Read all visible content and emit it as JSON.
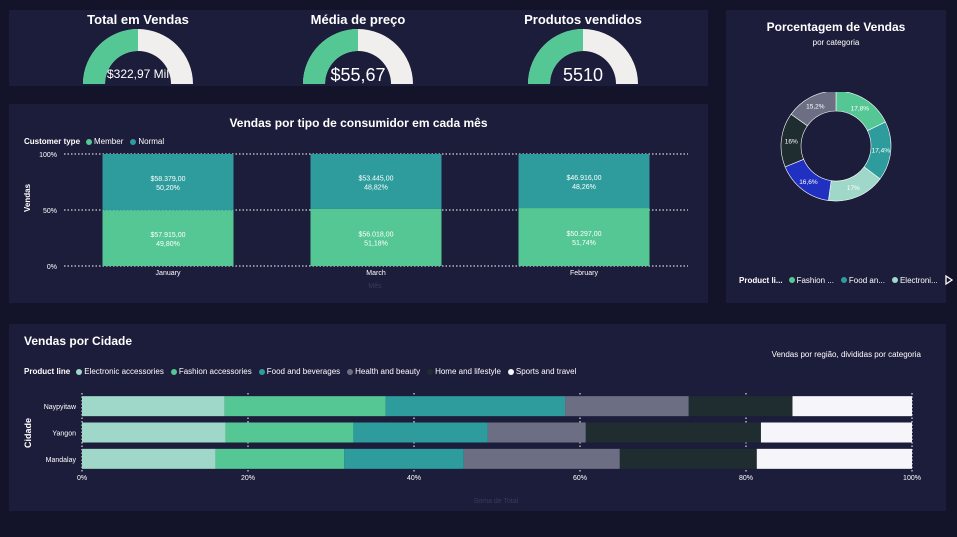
{
  "kpis": [
    {
      "title": "Total em Vendas",
      "value": "$322,97 Mil",
      "fraction": 0.5
    },
    {
      "title": "Média de preço",
      "value": "$55,67",
      "fraction": 0.5
    },
    {
      "title": "Produtos vendidos",
      "value": "5510",
      "fraction": 0.5
    }
  ],
  "colors": {
    "teal": "#2e9c9c",
    "green": "#55c795",
    "gauge_bg": "#f1eeee",
    "background": "#13132a",
    "panel": "#1c1c3b"
  },
  "monthly": {
    "title": "Vendas por tipo de consumidor em cada mês",
    "legend_title": "Customer type",
    "legend_items": [
      "Member",
      "Normal"
    ],
    "ylabel": "Vendas",
    "xlabel": "Mês",
    "yticks": [
      "100%",
      "50%",
      "0%"
    ]
  },
  "chart_data": [
    {
      "type": "bar",
      "stacked": "100%",
      "title": "Vendas por tipo de consumidor em cada mês",
      "categories": [
        "January",
        "March",
        "February"
      ],
      "series": [
        {
          "name": "Normal",
          "values": [
            58379.0,
            53445.0,
            46916.0
          ],
          "labels": [
            "$58.379,00",
            "$53.445,00",
            "$46.916,00"
          ],
          "pct_labels": [
            "50,20%",
            "48,82%",
            "48,26%"
          ]
        },
        {
          "name": "Member",
          "values": [
            57915.0,
            56018.0,
            50297.0
          ],
          "labels": [
            "$57.915,00",
            "$56.018,00",
            "$50.297,00"
          ],
          "pct_labels": [
            "49,80%",
            "51,18%",
            "51,74%"
          ]
        }
      ],
      "ylim": [
        0,
        100
      ],
      "grid": true,
      "legend_position": "top-left"
    },
    {
      "type": "pie",
      "title": "Porcentagem de Vendas",
      "subtitle": "por categoria",
      "donut": true,
      "slices": [
        {
          "label": "17,8%",
          "value": 17.8,
          "color": "#55c795"
        },
        {
          "label": "17,4%",
          "value": 17.4,
          "color": "#2e9c9c"
        },
        {
          "label": "17%",
          "value": 17.0,
          "color": "#9fd8c8"
        },
        {
          "label": "16,6%",
          "value": 16.6,
          "color": "#2030c0"
        },
        {
          "label": "16%",
          "value": 16.0,
          "color": "#1f2c30"
        },
        {
          "label": "15,2%",
          "value": 15.2,
          "color": "#6c6f84"
        }
      ],
      "legend_title": "Product li...",
      "legend_items": [
        "Fashion ...",
        "Food an...",
        "Electroni..."
      ],
      "legend_colors": [
        "#55c795",
        "#2e9c9c",
        "#9fd8c8"
      ]
    },
    {
      "type": "bar",
      "orientation": "horizontal",
      "stacked": "100%",
      "title": "Vendas por Cidade",
      "subtitle": "Vendas por região, divididas por categoria",
      "legend_title": "Product line",
      "categories": [
        "Naypyitaw",
        "Yangon",
        "Mandalay"
      ],
      "series": [
        {
          "name": "Electronic accessories",
          "color": "#9fd8c8",
          "values": [
            17.2,
            17.3,
            16.1
          ]
        },
        {
          "name": "Fashion accessories",
          "color": "#55c795",
          "values": [
            19.4,
            15.4,
            15.5
          ]
        },
        {
          "name": "Food and beverages",
          "color": "#2e9c9c",
          "values": [
            21.6,
            16.2,
            14.4
          ]
        },
        {
          "name": "Health and beauty",
          "color": "#6c6f84",
          "values": [
            14.9,
            11.8,
            18.8
          ]
        },
        {
          "name": "Home and lifestyle",
          "color": "#1f2c30",
          "values": [
            12.5,
            21.1,
            16.5
          ]
        },
        {
          "name": "Sports and travel",
          "color": "#f6f6fa",
          "values": [
            14.4,
            18.2,
            18.7
          ]
        }
      ],
      "ylabel": "Cidade",
      "xlabel": "Soma de Total",
      "xticks": [
        "0%",
        "20%",
        "40%",
        "60%",
        "80%",
        "100%"
      ],
      "xlim": [
        0,
        100
      ]
    }
  ]
}
